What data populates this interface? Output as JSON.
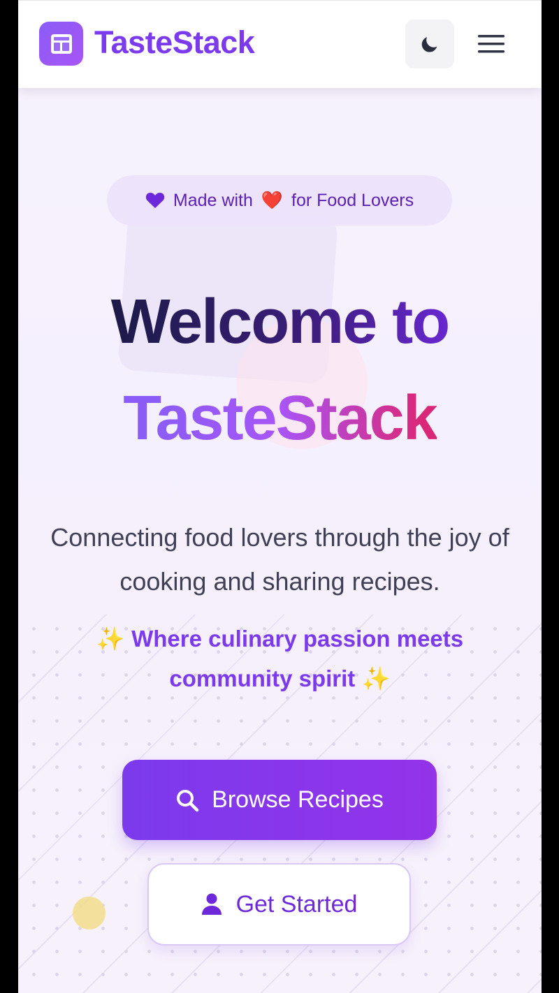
{
  "header": {
    "brand": "TasteStack",
    "theme_toggle_icon": "moon-icon",
    "menu_icon": "hamburger-icon"
  },
  "hero": {
    "badge_prefix": "Made with",
    "badge_emoji": "❤️",
    "badge_suffix": "for Food Lovers",
    "title_line1": "Welcome to",
    "title_line2": "TasteStack",
    "subtitle": "Connecting food lovers through the joy of cooking and sharing recipes.",
    "tagline": "✨ Where culinary passion meets community spirit ✨"
  },
  "actions": {
    "browse_label": "Browse Recipes",
    "get_started_label": "Get Started"
  },
  "colors": {
    "brand": "#7c3aed",
    "accent_pink": "#db2777",
    "text_dark": "#1e1b4b"
  }
}
